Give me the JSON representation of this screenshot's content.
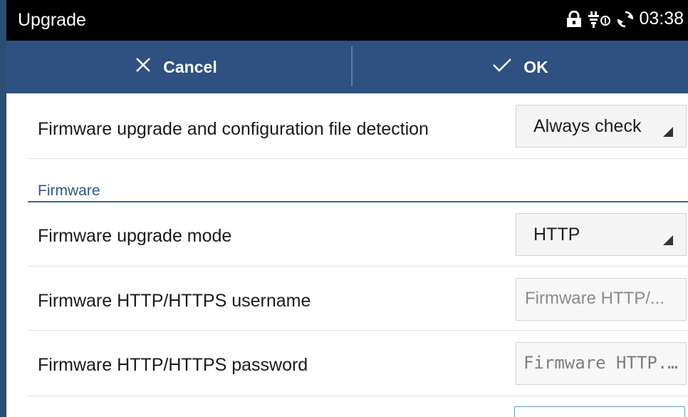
{
  "status_bar": {
    "title": "Upgrade",
    "time": "03:38",
    "icons": [
      "lock-icon",
      "usb-icon",
      "sync-icon"
    ]
  },
  "action_bar": {
    "cancel_label": "Cancel",
    "ok_label": "OK",
    "background": "#2e5181"
  },
  "settings": {
    "detection": {
      "label": "Firmware upgrade and configuration file detection",
      "value": "Always check"
    },
    "firmware_section": {
      "title": "Firmware"
    },
    "upgrade_mode": {
      "label": "Firmware upgrade mode",
      "value": "HTTP"
    },
    "username": {
      "label": "Firmware HTTP/HTTPS username",
      "placeholder": "Firmware HTTP/..."
    },
    "password": {
      "label": "Firmware HTTP/HTTPS password",
      "placeholder": "Firmware HTTP..."
    }
  }
}
